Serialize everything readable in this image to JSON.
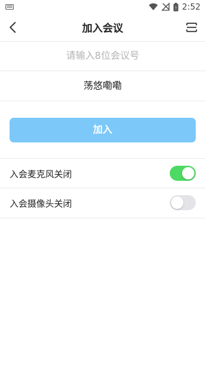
{
  "status_bar": {
    "time": "2:52",
    "icons": [
      "keyboard-icon",
      "wifi-icon",
      "no-signal-icon",
      "battery-icon"
    ]
  },
  "header": {
    "title": "加入会议",
    "back_icon": "chevron-left-icon",
    "history_icon": "list-icon"
  },
  "form": {
    "meeting_number": {
      "value": "",
      "placeholder": "请输入8位会议号"
    },
    "display_name": {
      "value": "荡悠嘞嘞"
    }
  },
  "join_button": {
    "label": "加入",
    "color": "#7cc8f8"
  },
  "settings": {
    "mic": {
      "label": "入会麦克风关闭",
      "enabled": true
    },
    "camera": {
      "label": "入会摄像头关闭",
      "enabled": false
    }
  },
  "colors": {
    "toggle_on": "#4cd964",
    "toggle_off": "#e4e4e8"
  }
}
